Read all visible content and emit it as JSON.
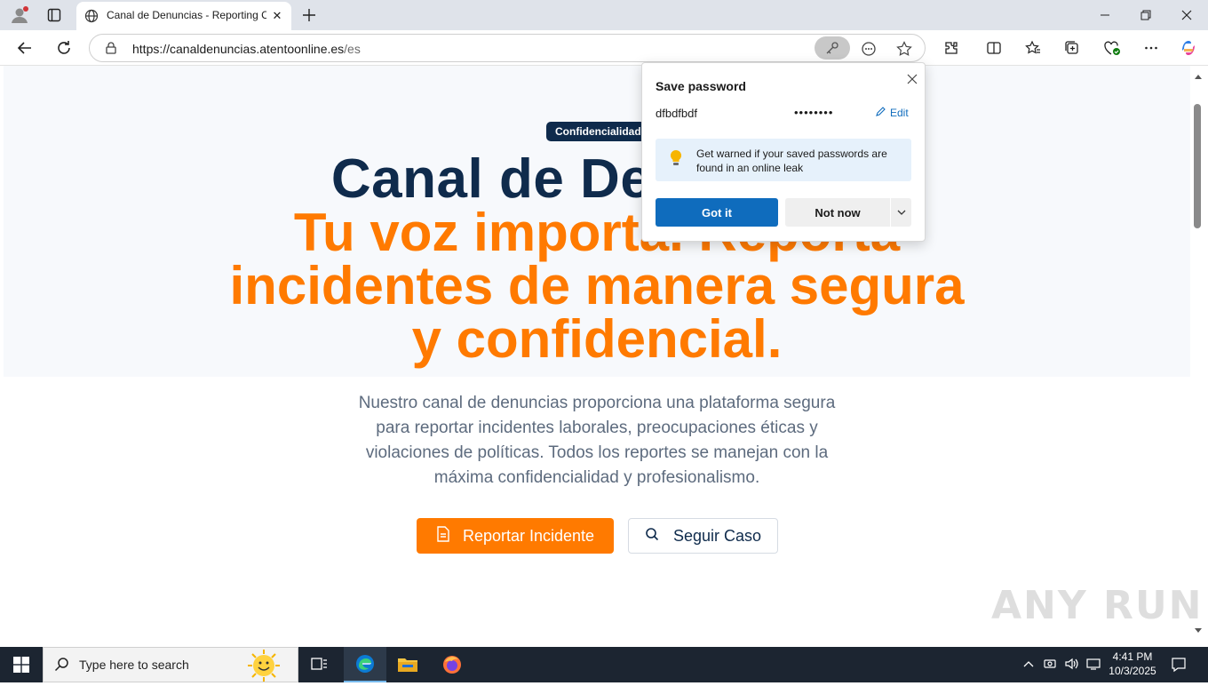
{
  "browser": {
    "tab_title": "Canal de Denuncias - Reporting C",
    "url_host": "https://canaldenuncias.atentoonline.es",
    "url_path": "/es"
  },
  "popup": {
    "title": "Save password",
    "username": "dfbdfbdf",
    "password_mask": "••••••••",
    "edit_label": "Edit",
    "leak_text": "Get warned if your saved passwords are found in an online leak",
    "got_it_label": "Got it",
    "not_now_label": "Not now"
  },
  "page": {
    "badge": "Confidencialidad",
    "heading_main": "Canal de Denuncias",
    "heading_sub": "Tu voz importa. Reporta incidentes de manera segura y confidencial.",
    "description": "Nuestro canal de denuncias proporciona una plataforma segura para reportar incidentes laborales, preocupaciones éticas y violaciones de políticas. Todos los reportes se manejan con la máxima confidencialidad y profesionalismo.",
    "report_button": "Reportar Incidente",
    "follow_button": "Seguir Caso"
  },
  "watermark": "ANY RUN",
  "taskbar": {
    "search_placeholder": "Type here to search",
    "time": "4:41 PM",
    "date": "10/3/2025"
  },
  "colors": {
    "navy": "#0f2b4c",
    "orange": "#ff7a00",
    "edge_blue": "#0f6cbd"
  }
}
